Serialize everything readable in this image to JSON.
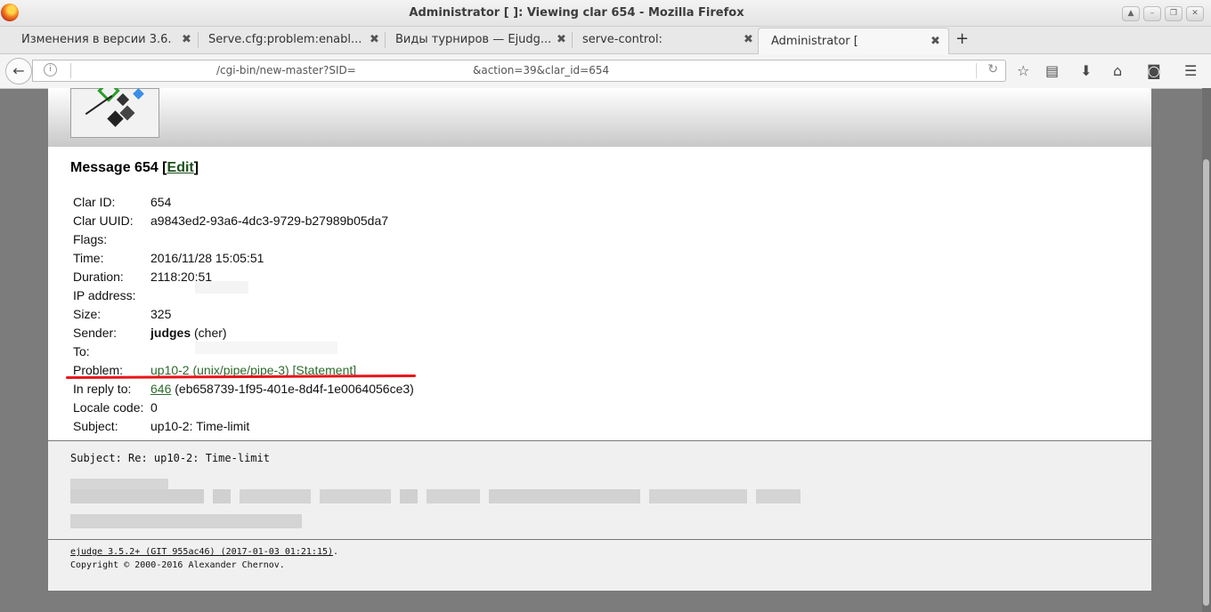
{
  "window": {
    "title": "Administrator [                                                         ]: Viewing clar 654 - Mozilla Firefox"
  },
  "tabs": [
    {
      "label": "Изменения в версии 3.6..."
    },
    {
      "label": "Serve.cfg:problem:enabl..."
    },
    {
      "label": "Виды турниров — Ejudg..."
    },
    {
      "label": "serve-control:"
    },
    {
      "label": "Administrator ["
    }
  ],
  "tab_close_glyph": "✖",
  "url": {
    "path": "/cgi-bin/new-master?SID=",
    "query": "&action=39&clar_id=654"
  },
  "message": {
    "title_prefix": "Message 654 [",
    "edit_link": "Edit",
    "title_suffix": "]"
  },
  "fields": {
    "clar_id": {
      "label": "Clar ID:",
      "value": "654"
    },
    "clar_uuid": {
      "label": "Clar UUID:",
      "value": "a9843ed2-93a6-4dc3-9729-b27989b05da7"
    },
    "flags": {
      "label": "Flags:",
      "value": ""
    },
    "time": {
      "label": "Time:",
      "value": "2016/11/28 15:05:51"
    },
    "duration": {
      "label": "Duration:",
      "value": "2118:20:51"
    },
    "ip": {
      "label": "IP address:",
      "value": ""
    },
    "size": {
      "label": "Size:",
      "value": "325"
    },
    "sender": {
      "label": "Sender:",
      "name": "judges",
      "login": " (cher)"
    },
    "to": {
      "label": "To:",
      "value": ""
    },
    "problem": {
      "label": "Problem:",
      "link": "up10-2 (unix/pipe/pipe-3)",
      "statement": "[Statement]"
    },
    "reply": {
      "label": "In reply to:",
      "link": "646",
      "uuid": " (eb658739-1f95-401e-8d4f-1e0064056ce3)"
    },
    "locale": {
      "label": "Locale code:",
      "value": "0"
    },
    "subject": {
      "label": "Subject:",
      "value": "up10-2: Time-limit"
    }
  },
  "body": {
    "subject_line": "Subject: Re: up10-2: Time-limit"
  },
  "footer": {
    "version_link": "ejudge 3.5.2+ (GIT 955ac46) (2017-01-03 01:21:15)",
    "period": ".",
    "copyright": "Copyright © 2000-2016 Alexander Chernov."
  },
  "colors": {
    "link": "#2b6b2b",
    "annotation": "#e8141a",
    "page_bg": "#7c7c7c"
  }
}
